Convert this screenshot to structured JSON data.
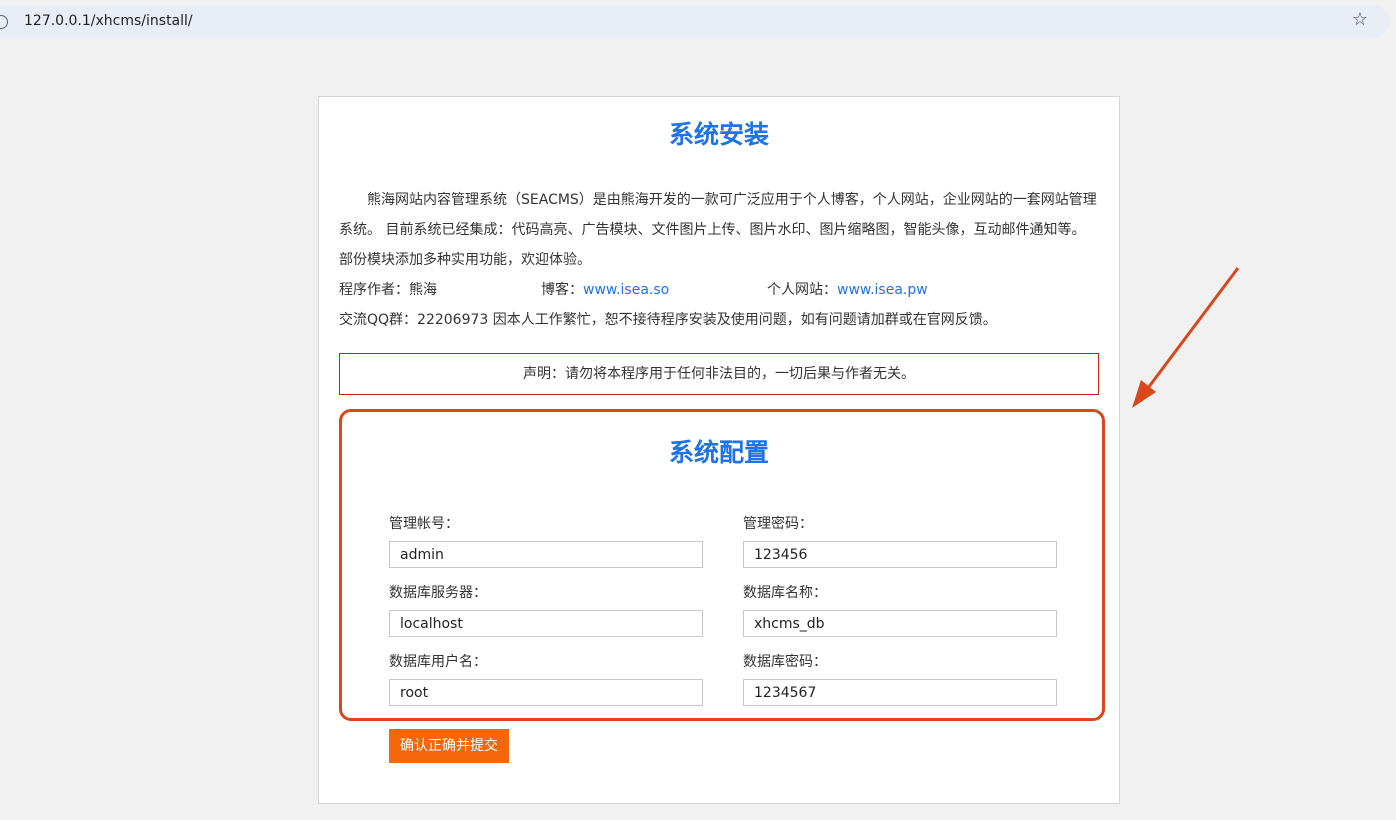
{
  "browser": {
    "url": "127.0.0.1/xhcms/install/"
  },
  "install": {
    "title": "系统安装",
    "intro_text": "熊海网站内容管理系统（SEACMS）是由熊海开发的一款可广泛应用于个人博客，个人网站，企业网站的一套网站管理系统。 目前系统已经集成：代码高亮、广告模块、文件图片上传、图片水印、图片缩略图，智能头像，互动邮件通知等。部份模块添加多种实用功能，欢迎体验。",
    "author_label": "程序作者：熊海",
    "blog_label": "博客：",
    "blog_link": "www.isea.so",
    "site_label": "个人网站：",
    "site_link": "www.isea.pw",
    "qq_text": "交流QQ群：22206973 因本人工作繁忙，恕不接待程序安装及使用问题，如有问题请加群或在官网反馈。",
    "notice": "声明：请勿将本程序用于任何非法目的，一切后果与作者无关。"
  },
  "config": {
    "title": "系统配置",
    "admin_user_label": "管理帐号：",
    "admin_user_value": "admin",
    "admin_pass_label": "管理密码：",
    "admin_pass_value": "123456",
    "db_host_label": "数据库服务器：",
    "db_host_value": "localhost",
    "db_name_label": "数据库名称：",
    "db_name_value": "xhcms_db",
    "db_user_label": "数据库用户名：",
    "db_user_value": "root",
    "db_pass_label": "数据库密码：",
    "db_pass_value": "1234567",
    "submit_label": "确认正确并提交"
  },
  "colors": {
    "accent_blue": "#1e73e8",
    "submit_orange": "#f5670a",
    "annotation_red": "#d9481c"
  }
}
